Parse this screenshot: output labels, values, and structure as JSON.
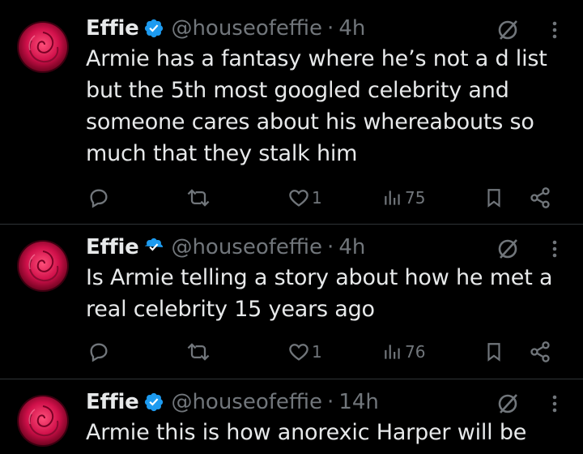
{
  "tweets": [
    {
      "display_name": "Effie",
      "handle": "@houseofeffie",
      "separator": "·",
      "time": "4h",
      "text": "Armie has a fantasy where he’s not a d list but the 5th most googled celebrity and someone cares about his whereabouts so much that they stalk him",
      "likes": "1",
      "views": "75"
    },
    {
      "display_name": "Effie",
      "handle": "@houseofeffie",
      "separator": "·",
      "time": "4h",
      "text": "Is Armie telling a story about how he met a real celebrity 15 years ago",
      "likes": "1",
      "views": "76"
    },
    {
      "display_name": "Effie",
      "handle": "@houseofeffie",
      "separator": "·",
      "time": "14h",
      "text": "Armie this is how anorexic Harper will be"
    }
  ],
  "icons": {
    "reply": "reply-icon",
    "retweet": "retweet-icon",
    "like": "heart-icon",
    "views": "views-icon",
    "bookmark": "bookmark-icon",
    "share": "share-icon",
    "grok": "grok-icon",
    "more": "more-icon",
    "verified": "verified-badge-icon"
  },
  "colors": {
    "background": "#000000",
    "text": "#e7e9ea",
    "secondary": "#71767b",
    "divider": "#2f3336",
    "verified": "#1d9bf0"
  }
}
